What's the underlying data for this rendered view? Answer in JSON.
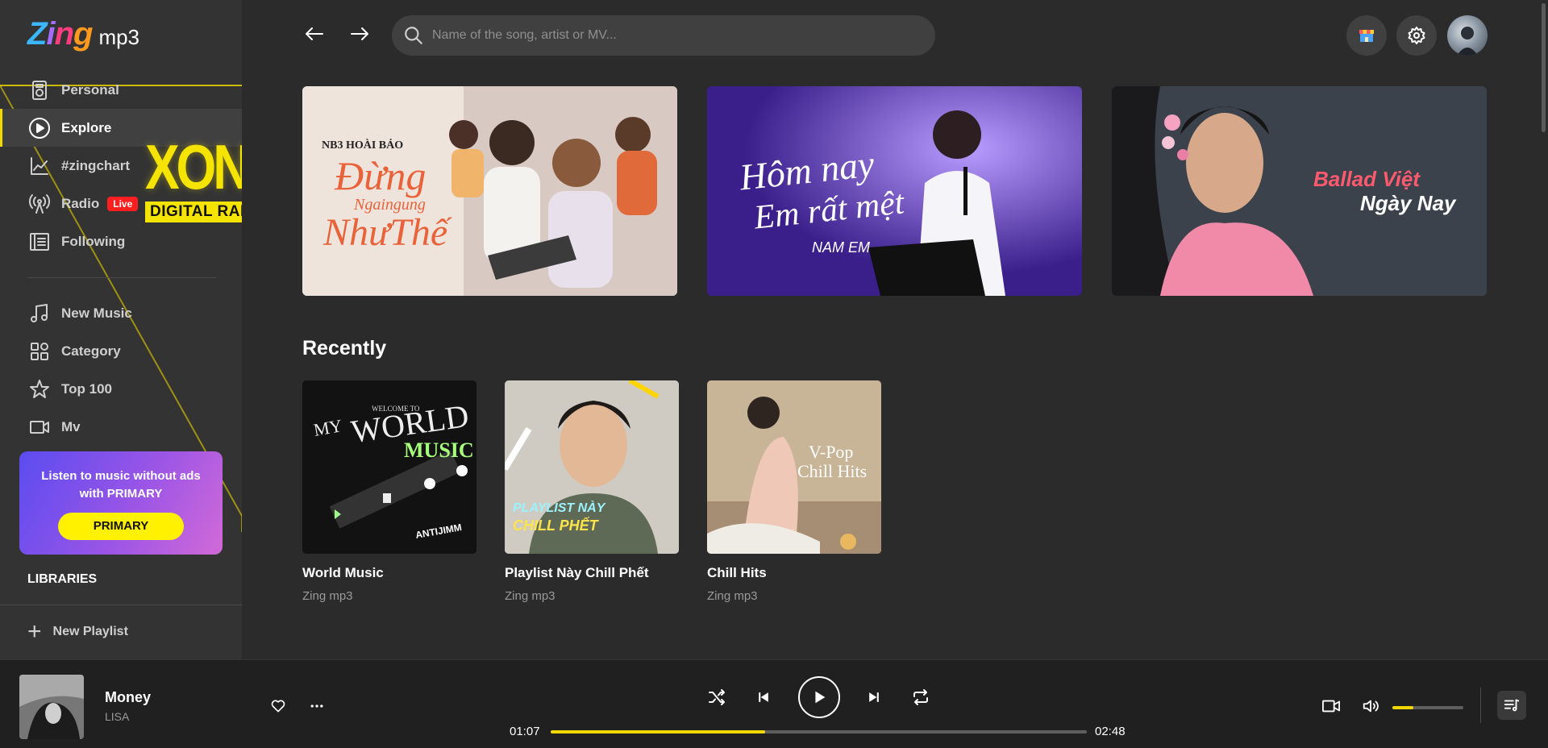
{
  "app": {
    "logo_main": "Zing",
    "logo_sub": "mp3"
  },
  "sidebar": {
    "items": [
      {
        "label": "Personal",
        "icon": "radio-device-icon"
      },
      {
        "label": "Explore",
        "icon": "play-circle-icon",
        "active": true
      },
      {
        "label": "#zingchart",
        "icon": "chart-line-icon"
      },
      {
        "label": "Radio",
        "icon": "broadcast-icon",
        "badge": "Live"
      },
      {
        "label": "Following",
        "icon": "news-icon"
      }
    ],
    "items2": [
      {
        "label": "New Music",
        "icon": "music-note-icon"
      },
      {
        "label": "Category",
        "icon": "grid-icon"
      },
      {
        "label": "Top 100",
        "icon": "star-icon"
      },
      {
        "label": "Mv",
        "icon": "video-icon"
      }
    ],
    "xone": {
      "title": "XONE",
      "subtitle": "DIGITAL RADIO"
    },
    "promo": {
      "text": "Listen to music without ads with PRIMARY",
      "button": "PRIMARY"
    },
    "libraries_label": "LIBRARIES",
    "new_playlist_label": "New Playlist"
  },
  "header": {
    "search_placeholder": "Name of the song, artist or MV..."
  },
  "banners": [
    {
      "tag": "NB3 HOÀI BẢO",
      "line1": "Đừng",
      "line2": "Ngaingung",
      "line3": "NhưThế"
    },
    {
      "line1": "Hôm nay",
      "line2": "Em rất mệt",
      "artist": "NAM EM"
    },
    {
      "line1": "Ballad Việt",
      "line2": "Ngày Nay"
    }
  ],
  "recently": {
    "title": "Recently",
    "cards": [
      {
        "title": "World Music",
        "subtitle": "Zing mp3",
        "art_line1": "MY",
        "art_line2": "WORLD",
        "art_line3": "MUSIC",
        "art_tag": "ANTIJIMM",
        "art_welcome": "WELCOME TO"
      },
      {
        "title": "Playlist Này Chill Phết",
        "subtitle": "Zing mp3",
        "art_line1": "PLAYLIST NÀY",
        "art_line2": "CHILL PHẾT"
      },
      {
        "title": "Chill Hits",
        "subtitle": "Zing mp3",
        "art_line1": "V-Pop",
        "art_line2": "Chill Hits"
      }
    ]
  },
  "player": {
    "title": "Money",
    "artist": "LISA",
    "current_time": "01:07",
    "total_time": "02:48",
    "progress": 0.4,
    "volume": 0.3
  },
  "colors": {
    "accent": "#f0d800",
    "background": "#2b2b2b",
    "sidebar": "#333333",
    "player": "#202020"
  }
}
